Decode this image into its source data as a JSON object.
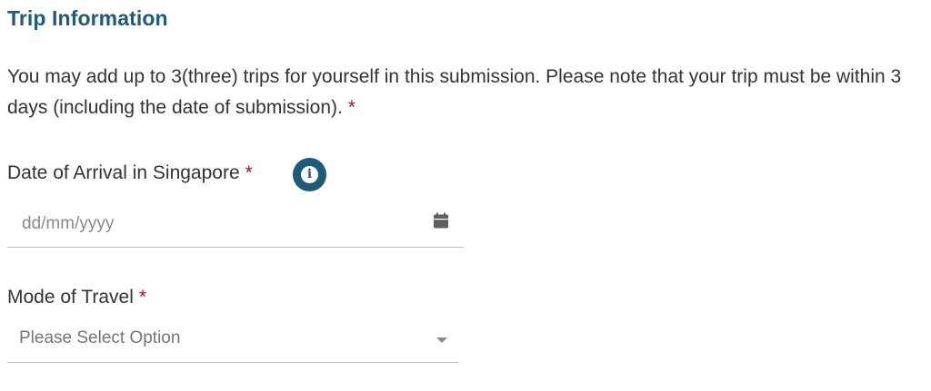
{
  "trip_info": {
    "title": "Trip Information",
    "intro_text": "You may add up to 3(three) trips for yourself in this submission. Please note that your trip must be within 3 days (including the date of submission).",
    "required_marker": "*"
  },
  "arrival": {
    "label": "Date of Arrival in Singapore",
    "required_marker": "*",
    "placeholder": "dd/mm/yyyy",
    "info_icon": "info-icon",
    "calendar_icon": "calendar-icon"
  },
  "mode_of_travel": {
    "label": "Mode of Travel",
    "required_marker": "*",
    "selected": "Please Select Option",
    "dropdown_icon": "chevron-down-icon"
  },
  "colors": {
    "accent": "#1f5a78",
    "required": "#d0021b",
    "text": "#333333",
    "divider": "#bdbdbd"
  }
}
